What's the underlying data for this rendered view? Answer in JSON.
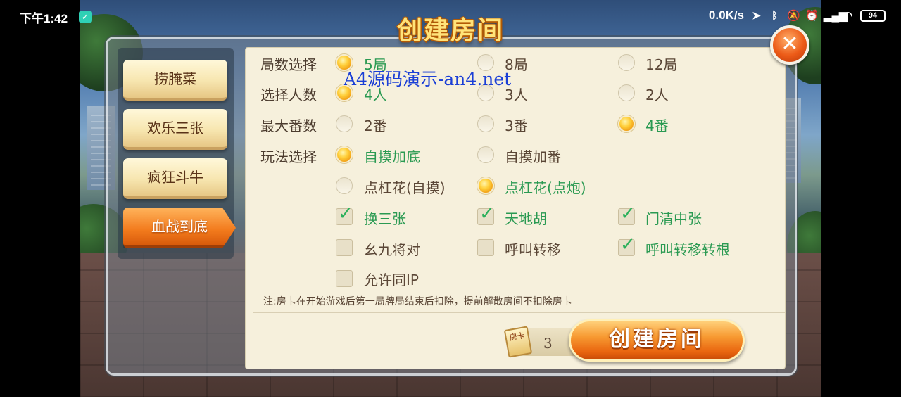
{
  "status_bar": {
    "time": "下午1:42",
    "network_speed": "0.0K/s",
    "battery": "94",
    "icons": [
      "app-notification-icon",
      "location-icon",
      "bluetooth-icon",
      "mute-icon",
      "alarm-icon",
      "signal-icon",
      "wifi-icon",
      "battery-icon"
    ]
  },
  "dialog": {
    "title": "创建房间",
    "close_label": "✕",
    "tabs": [
      {
        "label": "捞腌菜",
        "active": false
      },
      {
        "label": "欢乐三张",
        "active": false
      },
      {
        "label": "疯狂斗牛",
        "active": false
      },
      {
        "label": "血战到底",
        "active": true
      }
    ],
    "rows": {
      "rounds": {
        "label": "局数选择",
        "options": [
          {
            "text": "5局",
            "selected": true
          },
          {
            "text": "8局",
            "selected": false
          },
          {
            "text": "12局",
            "selected": false
          }
        ]
      },
      "players": {
        "label": "选择人数",
        "options": [
          {
            "text": "4人",
            "selected": true
          },
          {
            "text": "3人",
            "selected": false
          },
          {
            "text": "2人",
            "selected": false
          }
        ]
      },
      "max_fan": {
        "label": "最大番数",
        "options": [
          {
            "text": "2番",
            "selected": false
          },
          {
            "text": "3番",
            "selected": false
          },
          {
            "text": "4番",
            "selected": true
          }
        ]
      },
      "play_mode": {
        "label": "玩法选择",
        "options_row1": [
          {
            "text": "自摸加底",
            "selected": true
          },
          {
            "text": "自摸加番",
            "selected": false
          }
        ],
        "options_row2": [
          {
            "text": "点杠花(自摸)",
            "selected": false
          },
          {
            "text": "点杠花(点炮)",
            "selected": true
          }
        ]
      }
    },
    "checkboxes": [
      {
        "text": "换三张",
        "checked": true
      },
      {
        "text": "天地胡",
        "checked": true
      },
      {
        "text": "门清中张",
        "checked": true
      },
      {
        "text": "幺九将对",
        "checked": false
      },
      {
        "text": "呼叫转移",
        "checked": false
      },
      {
        "text": "呼叫转移转根",
        "checked": true
      },
      {
        "text": "允许同IP",
        "checked": false
      }
    ],
    "watermark": "A4源码演示-an4.net",
    "note": "注:房卡在开始游戏后第一局牌局结束后扣除，提前解散房间不扣除房卡",
    "room_card": {
      "icon_label": "房卡",
      "count": "3"
    },
    "create_button": "创建房间"
  },
  "colors": {
    "selected_text": "#2a9a52",
    "normal_text": "#5a4636",
    "panel_bg": "#f6f0dc",
    "accent_orange": "#f27a1c",
    "watermark_blue": "#1b3fd6"
  }
}
